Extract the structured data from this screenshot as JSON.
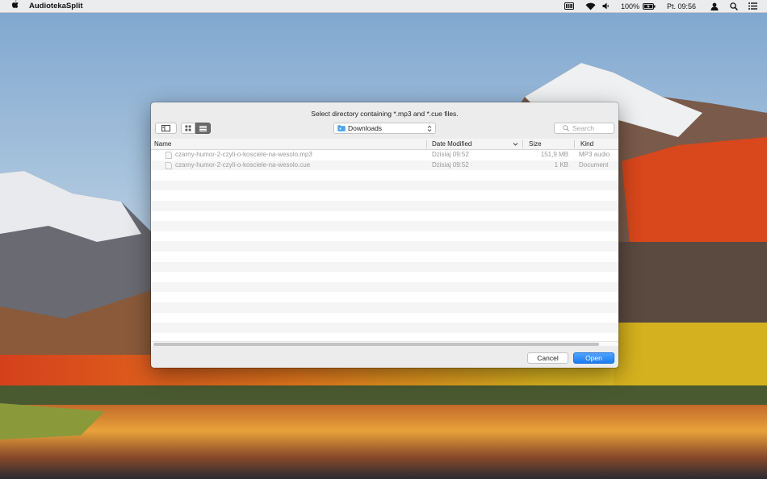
{
  "menubar": {
    "apple_icon": "apple-logo",
    "app_name": "AudiotekaSplit",
    "battery_percent": "100%",
    "clock": "Pt. 09:56",
    "icons": [
      "keyboard-input-icon",
      "wifi-icon",
      "volume-icon",
      "battery-charging-icon",
      "user-icon",
      "spotlight-search-icon"
    ]
  },
  "dialog": {
    "title": "Select directory containing *.mp3 and *.cue files.",
    "location": "Downloads",
    "search_placeholder": "Search",
    "columns": {
      "name": "Name",
      "date": "Date Modified",
      "size": "Size",
      "kind": "Kind"
    },
    "files": [
      {
        "name": "czarny-humor-2-czyli-o-kosciele-na-wesolo.mp3",
        "date": "Dzisiaj 09:52",
        "size": "151,9 MB",
        "kind": "MP3 audio"
      },
      {
        "name": "czarny-humor-2-czyli-o-kosciele-na-wesolo.cue",
        "date": "Dzisiaj 09:52",
        "size": "1 KB",
        "kind": "Document"
      }
    ],
    "cancel_label": "Cancel",
    "open_label": "Open"
  },
  "colors": {
    "accent": "#1b7cf2",
    "dialog_bg": "#ececec",
    "disabled_text": "#9a9a9a"
  }
}
